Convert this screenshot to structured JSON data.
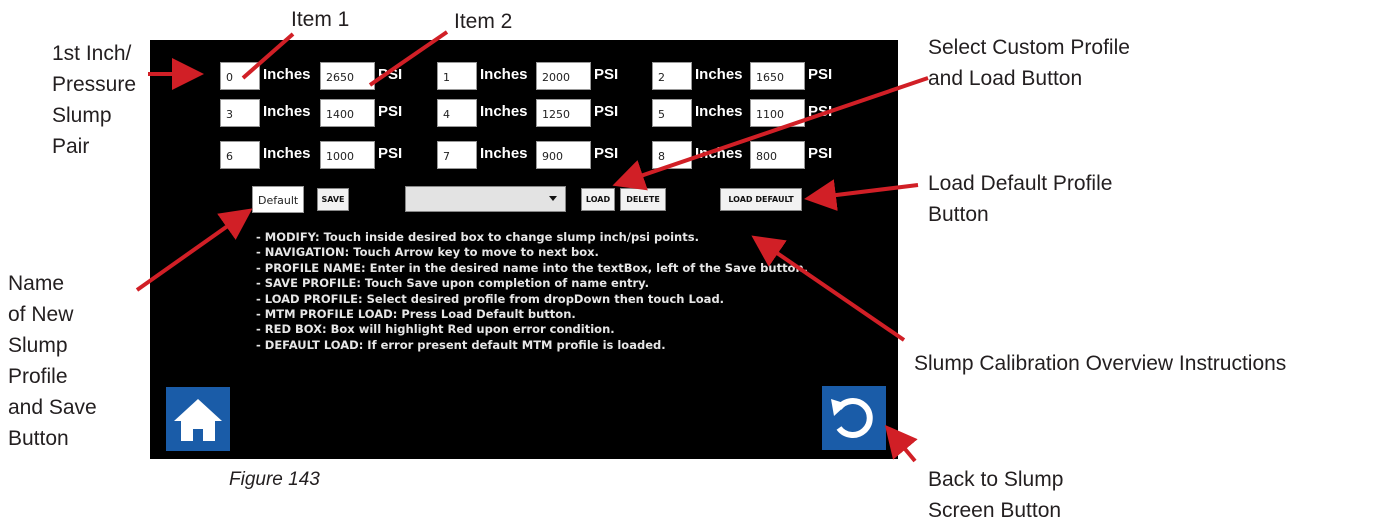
{
  "callouts": {
    "item1": "Item 1",
    "item2": "Item 2",
    "first_pair": [
      "1st Inch/",
      "Pressure",
      "Slump",
      "Pair"
    ],
    "select_custom": [
      "Select Custom Profile",
      "and Load Button"
    ],
    "load_default": [
      "Load Default Profile",
      "Button"
    ],
    "name_new": [
      "Name",
      "of New",
      "Slump",
      "Profile",
      "and Save",
      "Button"
    ],
    "overview": "Slump Calibration Overview Instructions",
    "back": [
      "Back to Slump",
      "Screen Button"
    ]
  },
  "figure_caption": "Figure 143",
  "units": {
    "inches": "Inches",
    "psi": "PSI"
  },
  "pairs": [
    {
      "index": "0",
      "psi": "2650"
    },
    {
      "index": "1",
      "psi": "2000"
    },
    {
      "index": "2",
      "psi": "1650"
    },
    {
      "index": "3",
      "psi": "1400"
    },
    {
      "index": "4",
      "psi": "1250"
    },
    {
      "index": "5",
      "psi": "1100"
    },
    {
      "index": "6",
      "psi": "1000"
    },
    {
      "index": "7",
      "psi": "900"
    },
    {
      "index": "8",
      "psi": "800"
    }
  ],
  "profile": {
    "name_value": "Default",
    "save_label": "SAVE",
    "dropdown_value": "",
    "load_label": "LOAD",
    "delete_label": "DELETE",
    "load_default_label": "LOAD DEFAULT"
  },
  "instructions": [
    "- MODIFY: Touch inside desired box to change slump inch/psi points.",
    "- NAVIGATION: Touch Arrow key to move to next box.",
    "- PROFILE NAME: Enter in the desired name into the textBox, left of the Save button.",
    "- SAVE PROFILE: Touch Save upon completion of name entry.",
    "- LOAD PROFILE: Select desired profile from dropDown then touch Load.",
    "- MTM PROFILE LOAD: Press Load Default button.",
    "- RED BOX: Box will highlight Red upon error condition.",
    "- DEFAULT LOAD: If error present default MTM profile is loaded."
  ],
  "icons": {
    "home": "home-icon",
    "back": "undo-icon",
    "dropdown": "caret-down-icon"
  },
  "colors": {
    "screen": "#000000",
    "icon_button": "#1a5ca8",
    "arrow": "#d11f26"
  }
}
